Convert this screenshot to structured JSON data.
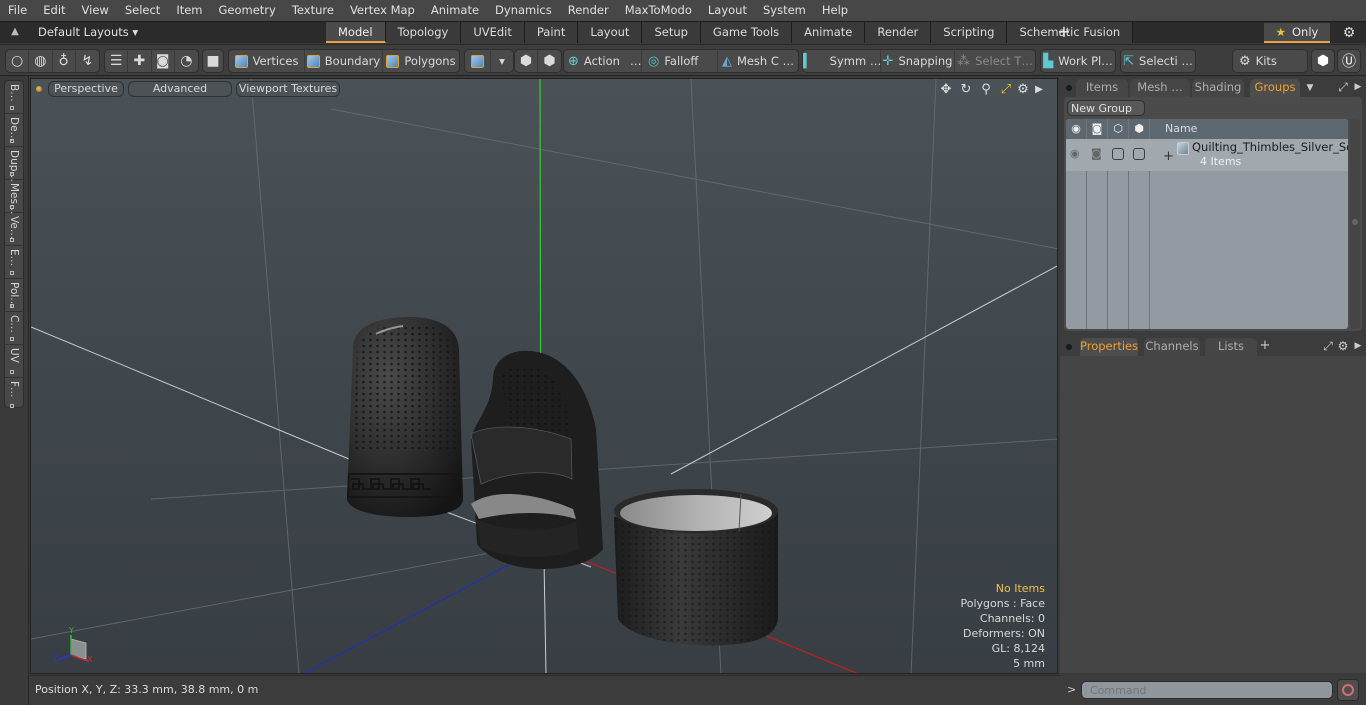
{
  "menubar": {
    "items": [
      "File",
      "Edit",
      "View",
      "Select",
      "Item",
      "Geometry",
      "Texture",
      "Vertex Map",
      "Animate",
      "Dynamics",
      "Render",
      "MaxToModo",
      "Layout",
      "System",
      "Help"
    ]
  },
  "layoutbar": {
    "layout_select": "Default Layouts ▾",
    "tabs": [
      "Model",
      "Topology",
      "UVEdit",
      "Paint",
      "Layout",
      "Setup",
      "Game Tools",
      "Animate",
      "Render",
      "Scripting",
      "Schematic Fusion"
    ],
    "active_tab": "Model",
    "add_label": "+",
    "only_label": "Only",
    "only_star": "★"
  },
  "toolbar": {
    "vertices": "Vertices",
    "boundary": "Boundary",
    "polygons": "Polygons",
    "action": "Action",
    "action_more": "…",
    "falloff": "Falloff",
    "mesh_c": "Mesh C …",
    "symm": "Symm …",
    "snapping": "Snapping",
    "select_t": "Select T…",
    "work_pl": "Work Pl…",
    "selecti": "Selecti …",
    "kits": "Kits"
  },
  "left_tabs": [
    "B…",
    "De…",
    "Dup…",
    "Mes…",
    "Ve…",
    "E…",
    "Pol…",
    "C…",
    "UV",
    "F…"
  ],
  "viewport": {
    "view_mode": "Perspective",
    "shading": "Advanced",
    "textures": "Viewport Textures",
    "info": {
      "selection": "No Items",
      "polygons": "Polygons : Face",
      "channels": "Channels: 0",
      "deformers": "Deformers: ON",
      "gl": "GL: 8,124",
      "scale": "5 mm"
    },
    "axis_labels": {
      "y": "Y",
      "z": "Z",
      "x": "X"
    },
    "colors": {
      "x_axis": "#c02020",
      "y_axis": "#30d030",
      "z_axis": "#2030b0",
      "info_highlight": "#f0c040"
    }
  },
  "groups_panel": {
    "tabs": [
      "Items",
      "Mesh …",
      "Shading",
      "Groups"
    ],
    "active_tab": "Groups",
    "new_group": "New Group",
    "column_name": "Name",
    "rows": [
      {
        "name": "Quilting_Thimbles_Silver_Set_…",
        "count": "4 Items",
        "expand": "+"
      }
    ]
  },
  "properties_panel": {
    "tabs": [
      "Properties",
      "Channels",
      "Lists"
    ],
    "active_tab": "Properties",
    "add_label": "+"
  },
  "statusbar": {
    "position": "Position X, Y, Z:   33.3 mm, 38.8 mm, 0 m"
  },
  "command": {
    "prompt": ">",
    "placeholder": "Command"
  },
  "accent_color": "#e8a040"
}
